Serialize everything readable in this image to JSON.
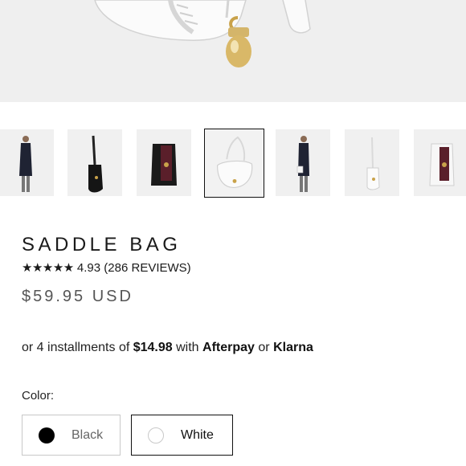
{
  "product": {
    "title": "SADDLE BAG",
    "rating_stars": "★★★★★",
    "rating_value": "4.93",
    "reviews": "(286 REVIEWS)",
    "rating": 4.93,
    "price": "$59.95 USD"
  },
  "installments": {
    "prefix": "or 4 installments of",
    "amount": "$14.98",
    "with": "with",
    "provider1": "Afterpay",
    "or": "or",
    "provider2": "Klarna"
  },
  "color": {
    "label": "Color:",
    "options": [
      {
        "name": "Black",
        "swatch": "#000000",
        "selected": false
      },
      {
        "name": "White",
        "swatch": "#ffffff",
        "selected": true
      }
    ]
  },
  "gallery": {
    "selected_index": 3,
    "thumbnails": [
      {
        "icon": "model-dark-coat-icon"
      },
      {
        "icon": "black-bag-strap-icon"
      },
      {
        "icon": "black-bag-open-icon"
      },
      {
        "icon": "white-bag-icon"
      },
      {
        "icon": "model-dark-coat-icon"
      },
      {
        "icon": "white-bag-strap-icon"
      },
      {
        "icon": "white-bag-open-icon"
      }
    ]
  },
  "colors": {
    "text": "#1a1a1a",
    "muted": "#555555",
    "border": "#c8c8c8",
    "hero_bg": "#efefef"
  }
}
